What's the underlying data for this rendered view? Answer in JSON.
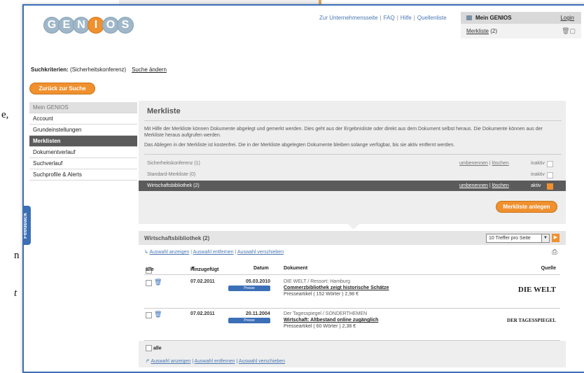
{
  "background": {
    "fragments": [
      "e,",
      "n",
      "t"
    ]
  },
  "header": {
    "logo_letters": [
      "G",
      "E",
      "N",
      "I",
      "O",
      "S"
    ],
    "top_links": [
      "Zur Unternehmensseite",
      "FAQ",
      "Hilfe",
      "Quellenliste"
    ],
    "account_title": "Mein GENIOS",
    "login": "Login",
    "merkliste_label": "Merkliste",
    "merkliste_count": "(2)"
  },
  "criteria": {
    "label": "Suchkriterien:",
    "value": "(Sicherheitskonferenz)",
    "change": "Suche ändern"
  },
  "back_button": "Zurück zur Suche",
  "sidebar": {
    "items": [
      "Mein GENIOS",
      "Account",
      "Grundeinstellungen",
      "Merklisten",
      "Dokumentverlauf",
      "Suchverlauf",
      "Suchprofile & Alerts"
    ],
    "active": "Merklisten"
  },
  "feedback": "Feedback",
  "merkliste_panel": {
    "title": "Merkliste",
    "text1": "Mit Hilfe der Merkliste können Dokumente abgelegt und gemerkt werden. Dies geht aus der Ergebnisliste oder direkt aus dem Dokument selbst heraus. Die Dokumente können aus der Merkliste heraus aufgrufen werden.",
    "text2": "Das Ablegen in der Merkliste ist kostenfrei. Die in der Merkliste abgelegten Dokumente bleiben solange verfügbar, bis sie aktiv entfernt werden.",
    "lists": [
      {
        "name": "Sicherheitskonferenz (1)",
        "rename": "umbenennen",
        "delete": "löschen",
        "status": "inaktiv"
      },
      {
        "name": "Standard-Merkliste (0)",
        "rename": "",
        "delete": "",
        "status": "inaktiv"
      },
      {
        "name": "Wirtschaftsbibliothek (2)",
        "rename": "umbenennen",
        "delete": "löschen",
        "status": "aktiv"
      }
    ],
    "create_button": "Merkliste anlegen"
  },
  "results": {
    "title": "Wirtschaftsbibliothek (2)",
    "per_page": "10 Treffer pro Seite",
    "actions": [
      "Auswahl anzeigen",
      "Auswahl entfernen",
      "Auswahl verschieben"
    ],
    "columns": {
      "all": "alle",
      "added": "Hinzugefügt",
      "date": "Datum",
      "document": "Dokument",
      "source": "Quelle"
    },
    "items": [
      {
        "added": "07.02.2011",
        "date": "05.03.2010",
        "badge": "Presse",
        "source_line": "DIE WELT / Ressort: Hamburg",
        "title": "Commerzbibliothek zeigt historische Schätze",
        "meta": "Presseartikel ( 152 Wörter ) 2,98 €",
        "quelle": "DIE WELT"
      },
      {
        "added": "07.02.2011",
        "date": "20.11.2004",
        "badge": "Presse",
        "source_line": "Der Tagesspiegel / SONDERTHEMEN",
        "title": "Wirtschaft: Altbestand online zugänglich",
        "meta": "Presseartikel ( 60 Wörter ) 2,38 €",
        "quelle": "DER TAGESSPIEGEL"
      }
    ],
    "footer_all": "alle"
  }
}
